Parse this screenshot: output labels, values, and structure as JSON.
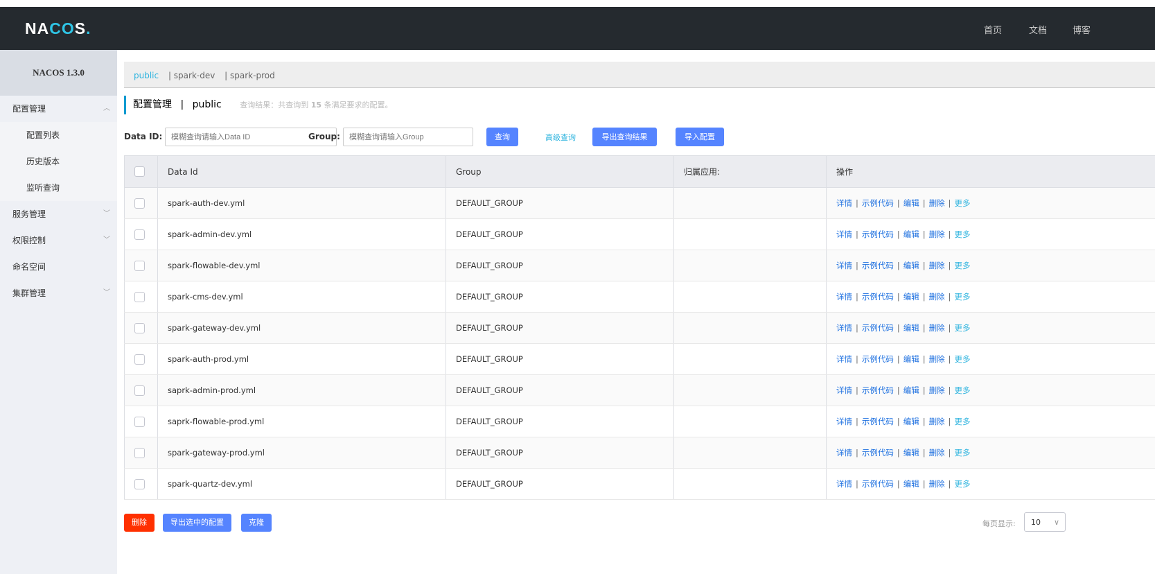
{
  "header": {
    "logo": "NACOS.",
    "nav": [
      "首页",
      "文档",
      "博客"
    ]
  },
  "sidebar": {
    "version": "NACOS 1.3.0",
    "items": [
      {
        "label": "配置管理",
        "chevron": "^",
        "sub": false
      },
      {
        "label": "配置列表",
        "sub": true
      },
      {
        "label": "历史版本",
        "sub": true
      },
      {
        "label": "监听查询",
        "sub": true
      },
      {
        "label": "服务管理",
        "chevron": "v",
        "sub": false
      },
      {
        "label": "权限控制",
        "chevron": "v",
        "sub": false
      },
      {
        "label": "命名空间",
        "sub": false
      },
      {
        "label": "集群管理",
        "chevron": "v",
        "sub": false
      }
    ]
  },
  "namespaces": [
    "public",
    "| spark-dev",
    "| spark-prod"
  ],
  "title": {
    "section": "配置管理",
    "sep": "|",
    "ns": "public",
    "hint_pre": "查询结果：共查询到 ",
    "count": "15",
    "hint_post": " 条满足要求的配置。"
  },
  "search": {
    "dataid_label": "Data ID:",
    "dataid_placeholder": "模糊查询请输入Data ID",
    "group_label": "Group:",
    "group_placeholder": "模糊查询请输入Group",
    "query": "查询",
    "advanced": "高级查询",
    "export_results": "导出查询结果",
    "import": "导入配置"
  },
  "table": {
    "headers": [
      "Data Id",
      "Group",
      "归属应用:",
      "操作"
    ],
    "ops": [
      "详情",
      "示例代码",
      "编辑",
      "删除",
      "更多"
    ],
    "rows": [
      {
        "data_id": "spark-auth-dev.yml",
        "group": "DEFAULT_GROUP",
        "app": ""
      },
      {
        "data_id": "spark-admin-dev.yml",
        "group": "DEFAULT_GROUP",
        "app": ""
      },
      {
        "data_id": "spark-flowable-dev.yml",
        "group": "DEFAULT_GROUP",
        "app": ""
      },
      {
        "data_id": "spark-cms-dev.yml",
        "group": "DEFAULT_GROUP",
        "app": ""
      },
      {
        "data_id": "spark-gateway-dev.yml",
        "group": "DEFAULT_GROUP",
        "app": ""
      },
      {
        "data_id": "spark-auth-prod.yml",
        "group": "DEFAULT_GROUP",
        "app": ""
      },
      {
        "data_id": "saprk-admin-prod.yml",
        "group": "DEFAULT_GROUP",
        "app": ""
      },
      {
        "data_id": "saprk-flowable-prod.yml",
        "group": "DEFAULT_GROUP",
        "app": ""
      },
      {
        "data_id": "spark-gateway-prod.yml",
        "group": "DEFAULT_GROUP",
        "app": ""
      },
      {
        "data_id": "spark-quartz-dev.yml",
        "group": "DEFAULT_GROUP",
        "app": ""
      }
    ]
  },
  "footer": {
    "delete": "删除",
    "export_selected": "导出选中的配置",
    "clone": "克隆",
    "page_size_label": "每页显示:",
    "page_size": "10"
  },
  "colors": {
    "header_bg": "#252a2f",
    "primary": "#5584ff",
    "danger": "#ff3000",
    "link": "#1f71e0",
    "accent": "#2fb4df"
  }
}
